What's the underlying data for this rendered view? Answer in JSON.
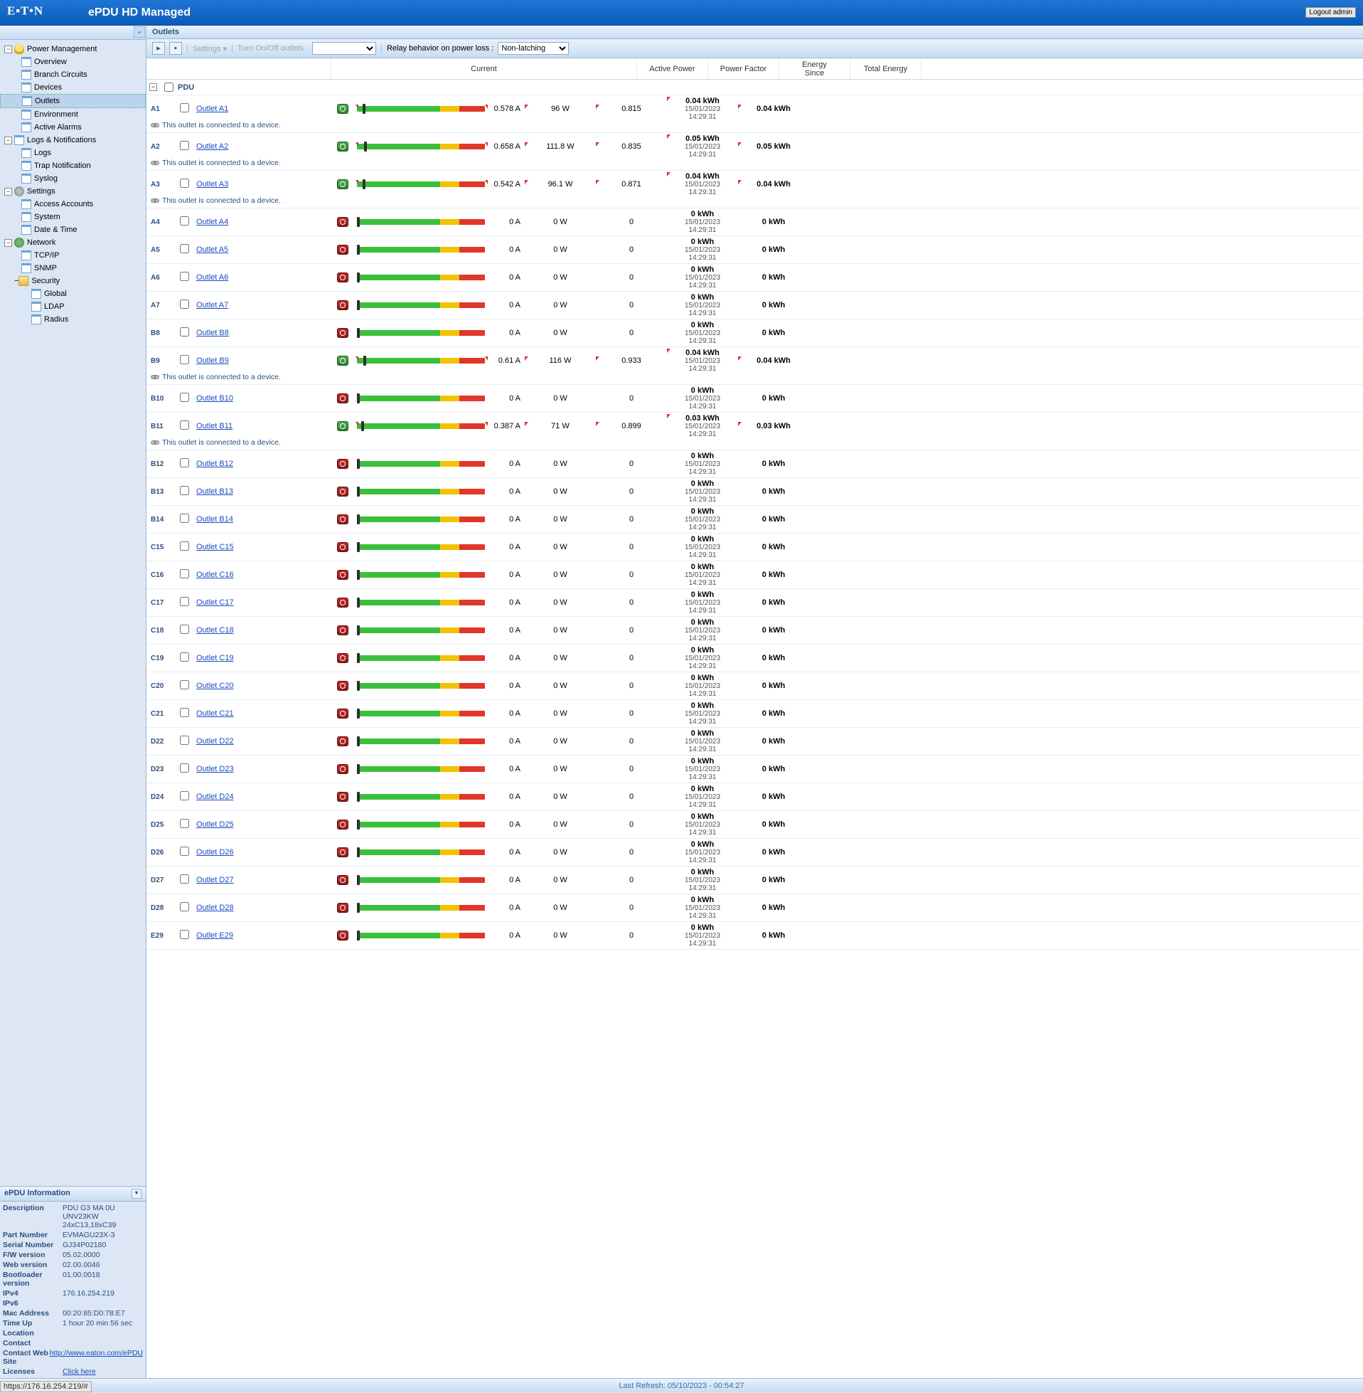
{
  "header": {
    "product": "ePDU HD Managed",
    "logout": "Logout admin"
  },
  "nav": {
    "groups": [
      {
        "label": "Power Management",
        "icon": "bulb",
        "items": [
          "Overview",
          "Branch Circuits",
          "Devices",
          "Outlets",
          "Environment",
          "Active Alarms"
        ],
        "selected": "Outlets"
      },
      {
        "label": "Logs & Notifications",
        "icon": "page",
        "items": [
          "Logs",
          "Trap Notification",
          "Syslog"
        ]
      },
      {
        "label": "Settings",
        "icon": "gear",
        "items": [
          "Access Accounts",
          "System",
          "Date & Time"
        ]
      },
      {
        "label": "Network",
        "icon": "globe",
        "items": [
          "TCP/IP",
          "SNMP"
        ],
        "sub": {
          "label": "Security",
          "icon": "folder",
          "items": [
            "Global",
            "LDAP",
            "Radius"
          ]
        }
      }
    ]
  },
  "info": {
    "title": "ePDU Information",
    "rows": [
      {
        "l": "Description",
        "v": "PDU G3 MA 0U UNV23KW 24xC13,18xC39"
      },
      {
        "l": "Part Number",
        "v": "EVMAGU23X-3"
      },
      {
        "l": "Serial Number",
        "v": "GJ34P02180"
      },
      {
        "l": "F/W version",
        "v": "05.02.0000"
      },
      {
        "l": "Web version",
        "v": "02.00.0046"
      },
      {
        "l": "Bootloader version",
        "v": "01.00.0018"
      },
      {
        "l": "IPv4",
        "v": "176.16.254.219"
      },
      {
        "l": "IPv6",
        "v": ""
      },
      {
        "l": "Mac Address",
        "v": "00:20:85:D0:78:E7"
      },
      {
        "l": "Time Up",
        "v": "1 hour 20 min 56 sec"
      },
      {
        "l": "Location",
        "v": ""
      },
      {
        "l": "Contact",
        "v": ""
      },
      {
        "l": "Contact Web Site",
        "v": "http://www.eaton.com/ePDU",
        "link": true
      },
      {
        "l": "Licenses",
        "v": "Click here",
        "link": true
      }
    ]
  },
  "panel": {
    "title": "Outlets",
    "settings": "Settings",
    "turn": "Turn On/Off outlets :",
    "relay_lbl": "Relay behavior on power loss :",
    "relay_val": "Non-latching",
    "cols": {
      "current": "Current",
      "ap": "Active Power",
      "pf": "Power Factor",
      "es1": "Energy",
      "es2": "Since",
      "te": "Total Energy"
    },
    "group": "PDU",
    "conn_note": "This outlet is connected to a device.",
    "ts": "15/01/2023 14:29:31"
  },
  "outlets": [
    {
      "id": "A1",
      "name": "Outlet A1",
      "on": true,
      "cur": "0.578 A",
      "mark": 8,
      "ap": "96 W",
      "pf": "0.815",
      "es": "0.04 kWh",
      "te": "0.04 kWh",
      "conn": true,
      "ticks": true
    },
    {
      "id": "A2",
      "name": "Outlet A2",
      "on": true,
      "cur": "0.658 A",
      "mark": 10,
      "ap": "111.8 W",
      "pf": "0.835",
      "es": "0.05 kWh",
      "te": "0.05 kWh",
      "conn": true,
      "ticks": true
    },
    {
      "id": "A3",
      "name": "Outlet A3",
      "on": true,
      "cur": "0.542 A",
      "mark": 8,
      "ap": "96.1 W",
      "pf": "0.871",
      "es": "0.04 kWh",
      "te": "0.04 kWh",
      "conn": true,
      "ticks": true
    },
    {
      "id": "A4",
      "name": "Outlet A4",
      "on": false,
      "cur": "0 A",
      "mark": 0,
      "ap": "0 W",
      "pf": "0",
      "es": "0 kWh",
      "te": "0 kWh"
    },
    {
      "id": "A5",
      "name": "Outlet A5",
      "on": false,
      "cur": "0 A",
      "mark": 0,
      "ap": "0 W",
      "pf": "0",
      "es": "0 kWh",
      "te": "0 kWh"
    },
    {
      "id": "A6",
      "name": "Outlet A6",
      "on": false,
      "cur": "0 A",
      "mark": 0,
      "ap": "0 W",
      "pf": "0",
      "es": "0 kWh",
      "te": "0 kWh"
    },
    {
      "id": "A7",
      "name": "Outlet A7",
      "on": false,
      "cur": "0 A",
      "mark": 0,
      "ap": "0 W",
      "pf": "0",
      "es": "0 kWh",
      "te": "0 kWh"
    },
    {
      "id": "B8",
      "name": "Outlet B8",
      "on": false,
      "cur": "0 A",
      "mark": 0,
      "ap": "0 W",
      "pf": "0",
      "es": "0 kWh",
      "te": "0 kWh"
    },
    {
      "id": "B9",
      "name": "Outlet B9",
      "on": true,
      "cur": "0.61 A",
      "mark": 9,
      "ap": "116 W",
      "pf": "0.933",
      "es": "0.04 kWh",
      "te": "0.04 kWh",
      "conn": true,
      "ticks": true
    },
    {
      "id": "B10",
      "name": "Outlet B10",
      "on": false,
      "cur": "0 A",
      "mark": 0,
      "ap": "0 W",
      "pf": "0",
      "es": "0 kWh",
      "te": "0 kWh"
    },
    {
      "id": "B11",
      "name": "Outlet B11",
      "on": true,
      "cur": "0.387 A",
      "mark": 6,
      "ap": "71 W",
      "pf": "0.899",
      "es": "0.03 kWh",
      "te": "0.03 kWh",
      "conn": true,
      "ticks": true
    },
    {
      "id": "B12",
      "name": "Outlet B12",
      "on": false,
      "cur": "0 A",
      "mark": 0,
      "ap": "0 W",
      "pf": "0",
      "es": "0 kWh",
      "te": "0 kWh"
    },
    {
      "id": "B13",
      "name": "Outlet B13",
      "on": false,
      "cur": "0 A",
      "mark": 0,
      "ap": "0 W",
      "pf": "0",
      "es": "0 kWh",
      "te": "0 kWh"
    },
    {
      "id": "B14",
      "name": "Outlet B14",
      "on": false,
      "cur": "0 A",
      "mark": 0,
      "ap": "0 W",
      "pf": "0",
      "es": "0 kWh",
      "te": "0 kWh"
    },
    {
      "id": "C15",
      "name": "Outlet C15",
      "on": false,
      "cur": "0 A",
      "mark": 0,
      "ap": "0 W",
      "pf": "0",
      "es": "0 kWh",
      "te": "0 kWh"
    },
    {
      "id": "C16",
      "name": "Outlet C16",
      "on": false,
      "cur": "0 A",
      "mark": 0,
      "ap": "0 W",
      "pf": "0",
      "es": "0 kWh",
      "te": "0 kWh"
    },
    {
      "id": "C17",
      "name": "Outlet C17",
      "on": false,
      "cur": "0 A",
      "mark": 0,
      "ap": "0 W",
      "pf": "0",
      "es": "0 kWh",
      "te": "0 kWh"
    },
    {
      "id": "C18",
      "name": "Outlet C18",
      "on": false,
      "cur": "0 A",
      "mark": 0,
      "ap": "0 W",
      "pf": "0",
      "es": "0 kWh",
      "te": "0 kWh"
    },
    {
      "id": "C19",
      "name": "Outlet C19",
      "on": false,
      "cur": "0 A",
      "mark": 0,
      "ap": "0 W",
      "pf": "0",
      "es": "0 kWh",
      "te": "0 kWh"
    },
    {
      "id": "C20",
      "name": "Outlet C20",
      "on": false,
      "cur": "0 A",
      "mark": 0,
      "ap": "0 W",
      "pf": "0",
      "es": "0 kWh",
      "te": "0 kWh"
    },
    {
      "id": "C21",
      "name": "Outlet C21",
      "on": false,
      "cur": "0 A",
      "mark": 0,
      "ap": "0 W",
      "pf": "0",
      "es": "0 kWh",
      "te": "0 kWh"
    },
    {
      "id": "D22",
      "name": "Outlet D22",
      "on": false,
      "cur": "0 A",
      "mark": 0,
      "ap": "0 W",
      "pf": "0",
      "es": "0 kWh",
      "te": "0 kWh"
    },
    {
      "id": "D23",
      "name": "Outlet D23",
      "on": false,
      "cur": "0 A",
      "mark": 0,
      "ap": "0 W",
      "pf": "0",
      "es": "0 kWh",
      "te": "0 kWh"
    },
    {
      "id": "D24",
      "name": "Outlet D24",
      "on": false,
      "cur": "0 A",
      "mark": 0,
      "ap": "0 W",
      "pf": "0",
      "es": "0 kWh",
      "te": "0 kWh"
    },
    {
      "id": "D25",
      "name": "Outlet D25",
      "on": false,
      "cur": "0 A",
      "mark": 0,
      "ap": "0 W",
      "pf": "0",
      "es": "0 kWh",
      "te": "0 kWh"
    },
    {
      "id": "D26",
      "name": "Outlet D26",
      "on": false,
      "cur": "0 A",
      "mark": 0,
      "ap": "0 W",
      "pf": "0",
      "es": "0 kWh",
      "te": "0 kWh"
    },
    {
      "id": "D27",
      "name": "Outlet D27",
      "on": false,
      "cur": "0 A",
      "mark": 0,
      "ap": "0 W",
      "pf": "0",
      "es": "0 kWh",
      "te": "0 kWh"
    },
    {
      "id": "D28",
      "name": "Outlet D28",
      "on": false,
      "cur": "0 A",
      "mark": 0,
      "ap": "0 W",
      "pf": "0",
      "es": "0 kWh",
      "te": "0 kWh"
    },
    {
      "id": "E29",
      "name": "Outlet E29",
      "on": false,
      "cur": "0 A",
      "mark": 0,
      "ap": "0 W",
      "pf": "0",
      "es": "0 kWh",
      "te": "0 kWh"
    }
  ],
  "status": {
    "refresh": "Last Refresh: 05/10/2023 - 00:54:27",
    "url": "https://176.16.254.219/#"
  }
}
